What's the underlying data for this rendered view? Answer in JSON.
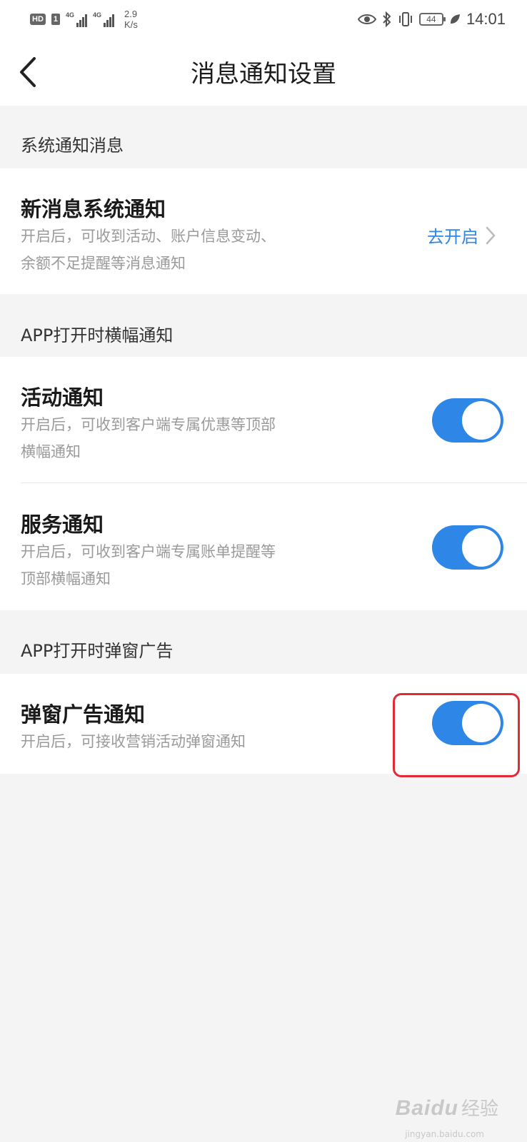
{
  "status_bar": {
    "hd": "HD",
    "sim": "1",
    "net1": "4G",
    "net2": "4G",
    "speed_value": "2.9",
    "speed_unit": "K/s",
    "battery": "44",
    "time": "14:01"
  },
  "header": {
    "title": "消息通知设置"
  },
  "sections": [
    {
      "label": "系统通知消息",
      "items": [
        {
          "title": "新消息系统通知",
          "desc_line1": "开启后，可收到活动、账户信息变动、",
          "desc_line2": "余额不足提醒等消息通知",
          "action_label": "去开启"
        }
      ]
    },
    {
      "label": "APP打开时横幅通知",
      "items": [
        {
          "title": "活动通知",
          "desc_line1": "开启后，可收到客户端专属优惠等顶部",
          "desc_line2": "横幅通知",
          "enabled": true
        },
        {
          "title": "服务通知",
          "desc_line1": "开启后，可收到客户端专属账单提醒等",
          "desc_line2": "顶部横幅通知",
          "enabled": true
        }
      ]
    },
    {
      "label": "APP打开时弹窗广告",
      "items": [
        {
          "title": "弹窗广告通知",
          "desc_line1": "开启后，可接收营销活动弹窗通知",
          "enabled": true
        }
      ]
    }
  ],
  "colors": {
    "accent": "#2e86e6",
    "highlight": "#e02b36"
  },
  "watermark": {
    "brand": "Baidu",
    "sub": "经验",
    "url": "jingyan.baidu.com"
  }
}
